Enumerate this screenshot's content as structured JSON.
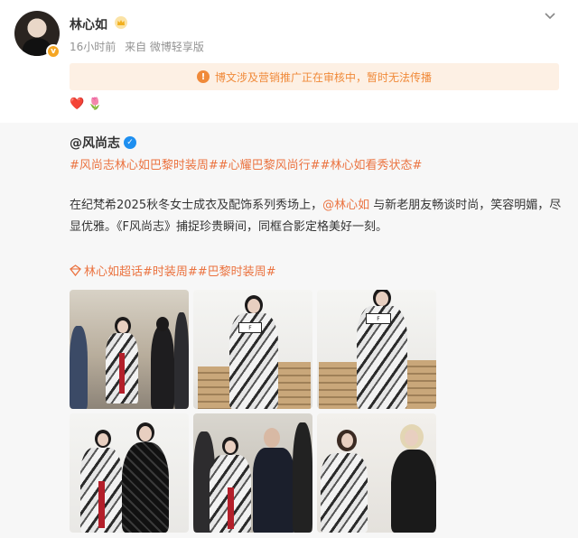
{
  "post": {
    "username": "林心如",
    "time": "16小时前",
    "source": "来自 微博轻享版",
    "notice": "博文涉及营销推广正在审核中，暂时无法传播",
    "emojis": [
      "❤️",
      "🌷"
    ]
  },
  "repost": {
    "author": "@风尚志",
    "tags": "#风尚志林心如巴黎时装周##心耀巴黎风尚行##林心如看秀状态#",
    "text_before": "在纪梵希2025秋冬女士成衣及配饰系列秀场上，",
    "mention": "@林心如",
    "text_after": " 与新老朋友畅谈时尚，笑容明媚，尽显优雅。《F风尚志》捕捉珍贵瞬间，同框合影定格美好一刻。",
    "super_topic": "林心如超话#时装周##巴黎时装周#",
    "photos": [
      {
        "name": "photo-1"
      },
      {
        "name": "photo-2"
      },
      {
        "name": "photo-3"
      },
      {
        "name": "photo-4"
      },
      {
        "name": "photo-5"
      },
      {
        "name": "photo-6"
      }
    ]
  },
  "colors": {
    "accent": "#eb7340",
    "notice_bg": "#fdf0e4",
    "notice_text": "#f08a3a",
    "verified_blue": "#1e8ff0"
  },
  "icons": [
    "crown-icon",
    "chevron-down-icon",
    "warning-icon",
    "verified-icon",
    "super-topic-icon"
  ]
}
